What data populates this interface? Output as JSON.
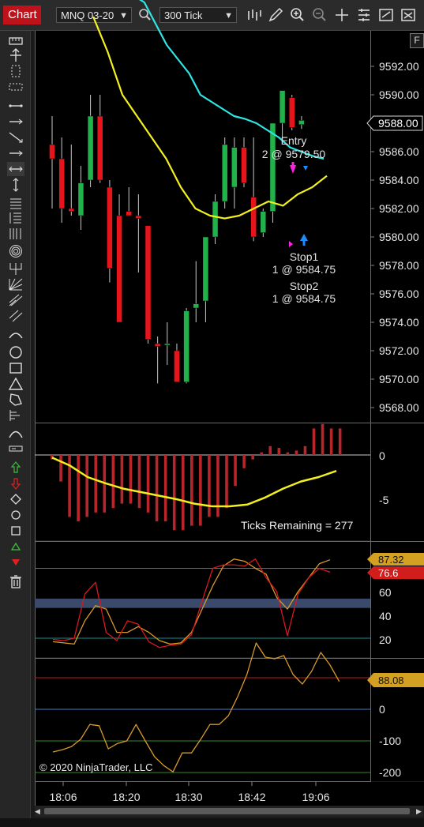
{
  "toolbar": {
    "tab_label": "Chart",
    "instrument": "MNQ 03-20",
    "interval": "300 Tick"
  },
  "panel_button": "F",
  "price_axis": {
    "labels": [
      "9592.00",
      "9590.00",
      "9588.00",
      "9586.00",
      "9584.00",
      "9582.00",
      "9580.00",
      "9578.00",
      "9576.00",
      "9574.00",
      "9572.00",
      "9570.00",
      "9568.00"
    ],
    "last_price": "9588.00"
  },
  "time_axis": {
    "labels": [
      "18:06",
      "18:20",
      "18:30",
      "18:42",
      "19:06"
    ]
  },
  "orders": {
    "entry_label": "Entry",
    "entry_qty": "2 @ 9579.50",
    "stop1_label": "Stop1",
    "stop1_qty": "1 @ 9584.75",
    "stop2_label": "Stop2",
    "stop2_qty": "1 @ 9584.75"
  },
  "momentum_axis": {
    "labels": [
      "0",
      "-5"
    ]
  },
  "ticks_remaining": "Ticks Remaining = 277",
  "stoch_axis": {
    "labels": [
      "60",
      "40",
      "20"
    ],
    "value_orange": "87.32",
    "value_red": "76.6"
  },
  "cci_axis": {
    "labels": [
      "0",
      "-100",
      "-200"
    ],
    "value": "88.08"
  },
  "copyright": "© 2020 NinjaTrader, LLC",
  "colors": {
    "up_candle": "#22b24c",
    "down_candle": "#e8141c",
    "ma_cyan": "#2ee6e6",
    "ma_yellow": "#f2f01e",
    "histogram": "#b8252b",
    "stoch_d": "#d99a2a",
    "stoch_k": "#d8191f",
    "cci": "#d99a2a"
  },
  "chart_data": {
    "type": "candlestick",
    "price_range": [
      9567,
      9595
    ],
    "candles": [
      {
        "o": 9586.5,
        "h": 9588.5,
        "l": 9582.0,
        "c": 9585.5
      },
      {
        "o": 9585.5,
        "h": 9587.0,
        "l": 9581.0,
        "c": 9582.0
      },
      {
        "o": 9582.0,
        "h": 9586.5,
        "l": 9581.5,
        "c": 9581.8
      },
      {
        "o": 9581.5,
        "h": 9585.0,
        "l": 9580.5,
        "c": 9583.8
      },
      {
        "o": 9584.0,
        "h": 9590.0,
        "l": 9583.5,
        "c": 9588.5
      },
      {
        "o": 9588.5,
        "h": 9590.0,
        "l": 9583.8,
        "c": 9584.0
      },
      {
        "o": 9583.5,
        "h": 9584.0,
        "l": 9576.8,
        "c": 9577.8
      },
      {
        "o": 9581.5,
        "h": 9583.0,
        "l": 9575.0,
        "c": 9574.0
      },
      {
        "o": 9581.8,
        "h": 9583.5,
        "l": 9581.5,
        "c": 9581.5
      },
      {
        "o": 9581.5,
        "h": 9583.0,
        "l": 9577.5,
        "c": 9581.3
      },
      {
        "o": 9580.8,
        "h": 9580.8,
        "l": 9572.5,
        "c": 9572.8
      },
      {
        "o": 9572.5,
        "h": 9573.0,
        "l": 9569.7,
        "c": 9572.3
      },
      {
        "o": 9572.5,
        "h": 9574.0,
        "l": 9571.0,
        "c": 9572.5
      },
      {
        "o": 9572.0,
        "h": 9572.5,
        "l": 9570.0,
        "c": 9569.8
      },
      {
        "o": 9569.8,
        "h": 9575.0,
        "l": 9569.7,
        "c": 9574.8
      },
      {
        "o": 9575.0,
        "h": 9578.3,
        "l": 9574.0,
        "c": 9575.3
      },
      {
        "o": 9575.5,
        "h": 9580.0,
        "l": 9574.0,
        "c": 9580.0
      },
      {
        "o": 9580.0,
        "h": 9583.0,
        "l": 9579.5,
        "c": 9582.5
      },
      {
        "o": 9582.5,
        "h": 9587.0,
        "l": 9582.0,
        "c": 9586.5
      },
      {
        "o": 9583.5,
        "h": 9587.0,
        "l": 9582.0,
        "c": 9586.3
      },
      {
        "o": 9586.3,
        "h": 9587.0,
        "l": 9583.5,
        "c": 9583.8
      },
      {
        "o": 9582.8,
        "h": 9587.0,
        "l": 9579.7,
        "c": 9580.0
      },
      {
        "o": 9580.3,
        "h": 9582.0,
        "l": 9580.0,
        "c": 9581.8
      },
      {
        "o": 9581.8,
        "h": 9588.0,
        "l": 9581.0,
        "c": 9588.0
      },
      {
        "o": 9588.0,
        "h": 9590.3,
        "l": 9586.5,
        "c": 9590.3
      },
      {
        "o": 9589.8,
        "h": 9590.0,
        "l": 9587.5,
        "c": 9587.7
      },
      {
        "o": 9587.9,
        "h": 9588.5,
        "l": 9587.6,
        "c": 9588.2
      }
    ],
    "ma_cyan": [
      9602.5,
      9600.0,
      9598.5,
      9597.0,
      9596.5,
      9595.0,
      9593.5,
      9592.5,
      9591.5,
      9590.0,
      9589.5,
      9589.0,
      9588.5,
      9588.3,
      9588.0,
      9587.5,
      9587.0,
      9586.3,
      9586.0,
      9585.7,
      9585.5
    ],
    "ma_yellow": [
      9595.5,
      9593.0,
      9590.0,
      9588.5,
      9587.0,
      9585.5,
      9583.5,
      9582.0,
      9581.5,
      9581.3,
      9581.5,
      9582.0,
      9582.5,
      9582.2,
      9583.0,
      9583.5,
      9584.3
    ],
    "momentum": [
      -0.5,
      -3.0,
      -7.0,
      -7.5,
      -7.0,
      -6.5,
      -6.5,
      -6.0,
      -5.5,
      -5.5,
      -6.0,
      -6.5,
      -7.5,
      -7.5,
      -8.5,
      -8.5,
      -8.0,
      -8.0,
      -7.0,
      -7.0,
      -6.0,
      -3.5,
      -1.5,
      -0.5,
      0.3,
      1.0,
      0.8,
      0.3,
      0.5,
      1.0,
      3.0,
      3.5,
      3.0,
      3.0
    ],
    "momentum_signal": [
      -0.3,
      -1.2,
      -2.5,
      -3.2,
      -3.8,
      -4.2,
      -4.6,
      -5.0,
      -5.5,
      -5.8,
      -5.8,
      -5.6,
      -4.8,
      -3.8,
      -3.0,
      -2.5,
      -1.8
    ],
    "stoch_k": [
      19,
      18,
      20,
      58,
      68,
      25,
      18,
      35,
      32,
      17,
      12,
      14,
      15,
      23,
      52,
      80,
      83,
      83,
      82,
      88,
      72,
      60,
      22,
      58,
      72,
      80,
      76.6
    ],
    "stoch_d": [
      17,
      16,
      15,
      35,
      48,
      45,
      25,
      25,
      30,
      25,
      18,
      15,
      16,
      25,
      45,
      65,
      82,
      88,
      86,
      80,
      75,
      55,
      45,
      60,
      72,
      84,
      87.32
    ],
    "cci": [
      -135,
      -128,
      -118,
      -95,
      -48,
      -52,
      -125,
      -108,
      -100,
      -48,
      -100,
      -150,
      -178,
      -198,
      -138,
      -138,
      -95,
      -48,
      -48,
      -20,
      40,
      110,
      210,
      165,
      160,
      170,
      110,
      80,
      120,
      180,
      140,
      88.08
    ]
  }
}
